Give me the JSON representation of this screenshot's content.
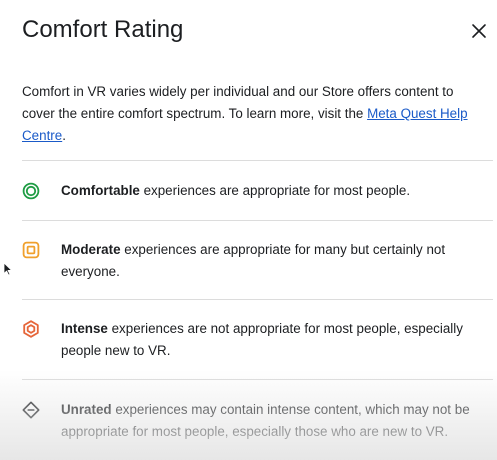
{
  "dialog": {
    "title": "Comfort Rating",
    "close_label": "×",
    "intro": {
      "text_before_link": "Comfort in VR varies widely per individual and our Store offers content to cover the entire comfort spectrum. To learn more, visit the ",
      "link_text": "Meta Quest Help Centre",
      "text_after_link": "."
    },
    "ratings": [
      {
        "name": "Comfortable",
        "description": " experiences are appropriate for most people.",
        "icon": "comfortable-icon",
        "color": "#1e9c43"
      },
      {
        "name": "Moderate",
        "description": " experiences are appropriate for many but certainly not everyone.",
        "icon": "moderate-icon",
        "color": "#f0a02c"
      },
      {
        "name": "Intense",
        "description": " experiences are not appropriate for most people, especially people new to VR.",
        "icon": "intense-icon",
        "color": "#e6663a"
      },
      {
        "name": "Unrated",
        "description": " experiences may contain intense content, which may not be appropriate for most people, especially those who are new to VR.",
        "icon": "unrated-icon",
        "color": "#1c1e21"
      }
    ]
  },
  "colors": {
    "link": "#1a5ac8",
    "text": "#1c1e21",
    "divider": "#dcdcdc"
  }
}
